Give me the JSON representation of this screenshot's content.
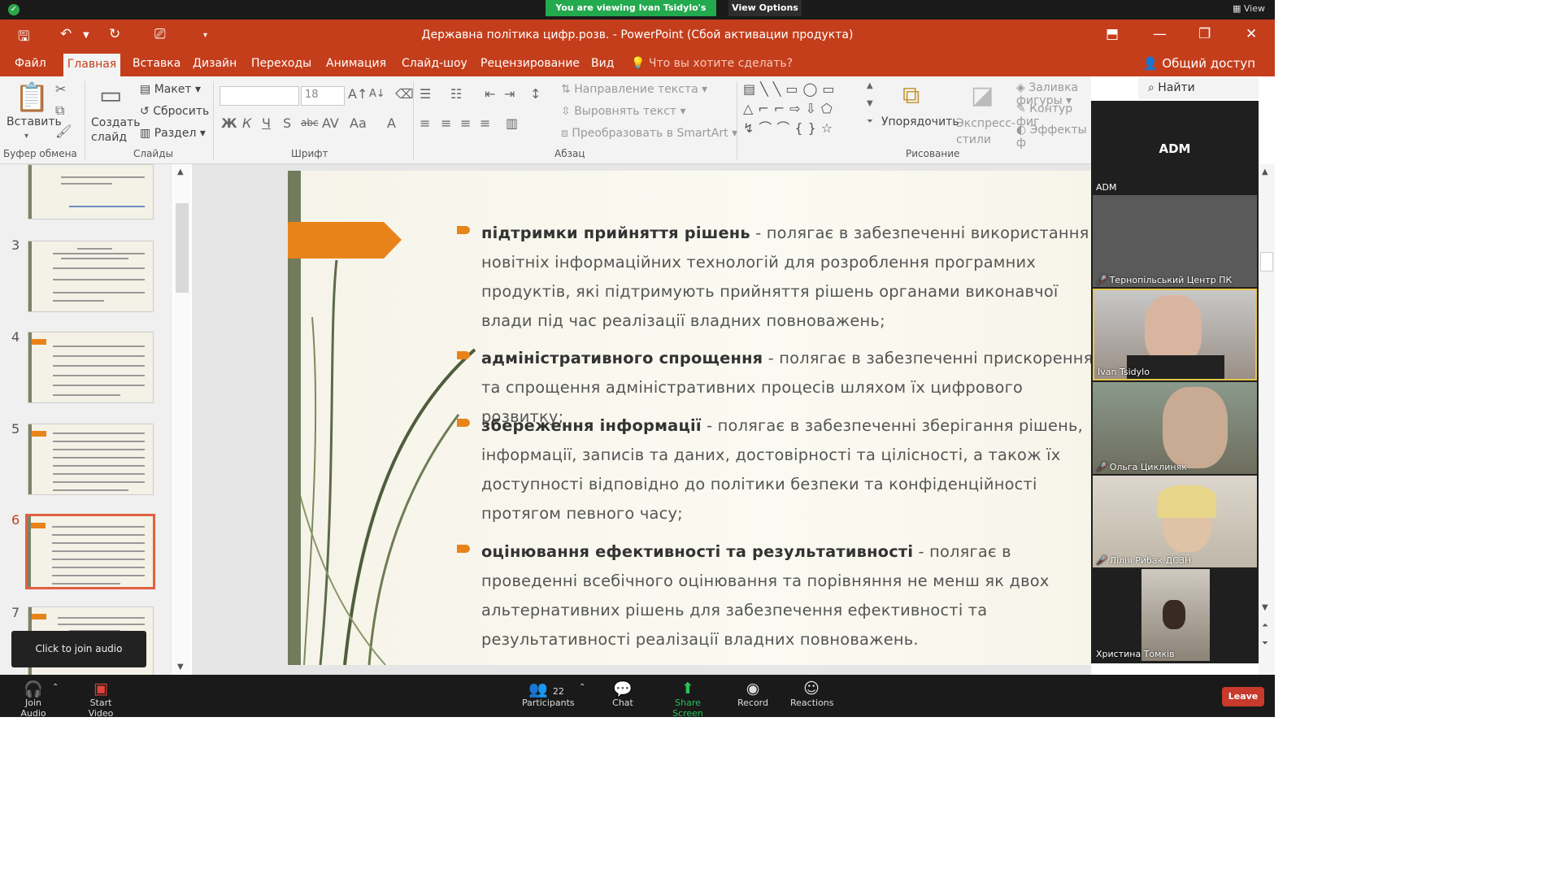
{
  "zoom_top": {
    "viewing": "You are viewing Ivan Tsidylo's screen",
    "view_options": "View Options",
    "view": "View"
  },
  "titlebar": {
    "title": "Державна політика цифр.розв. - PowerPoint (Сбой активации продукта)"
  },
  "menu": {
    "items": [
      "Файл",
      "Главная",
      "Вставка",
      "Дизайн",
      "Переходы",
      "Анимация",
      "Слайд-шоу",
      "Рецензирование",
      "Вид"
    ],
    "tell_me": "Что вы хотите сделать?",
    "share": "Общий доступ"
  },
  "ribbon": {
    "paste": "Вставить",
    "new_slide": "Создать слайд",
    "layout": "Макет",
    "reset": "Сбросить",
    "section": "Раздел",
    "font_size": "18",
    "text_direction": "Направление текста",
    "align_text": "Выровнять текст",
    "smartart": "Преобразовать в SmartArt",
    "arrange": "Упорядочить",
    "quick_styles": "Экспресс-стили",
    "shape_fill": "Заливка фигуры",
    "shape_outline": "Контур фиг",
    "shape_effects": "Эффекты ф",
    "find": "Найти",
    "groups": {
      "clipboard": "Буфер обмена",
      "slides": "Слайды",
      "font": "Шрифт",
      "paragraph": "Абзац",
      "drawing": "Рисование"
    }
  },
  "thumbnails": {
    "numbers": [
      "3",
      "4",
      "5",
      "6",
      "7"
    ],
    "selected": "6",
    "tooltip": "Click to join audio"
  },
  "slide": {
    "bullets": [
      {
        "bold": "підтримки прийняття рішень",
        "rest": " - полягає в забезпеченні використання новітніх інформаційних технологій для розроблення програмних продуктів, які підтримують прийняття рішень органами виконавчої влади під час реалізації владних повноважень;"
      },
      {
        "bold": "адміністративного спрощення",
        "rest": " - полягає в забезпеченні прискорення та спрощення адміністративних процесів шляхом їх цифрового розвитку;"
      },
      {
        "bold": "збереження інформації",
        "rest": " - полягає в забезпеченні зберігання рішень, інформації, записів та даних, достовірності та цілісності, а також їх доступності відповідно до політики безпеки та конфіденційності протягом певного часу;"
      },
      {
        "bold": "оцінювання ефективності та результативності",
        "rest": " - полягає в проведенні всебічного оцінювання та порівняння не менш як двох альтернативних рішень для забезпечення ефективності та результативності реалізації владних повноважень."
      }
    ]
  },
  "participants_panel": {
    "header": "ADM",
    "header_label": "ADM",
    "tiles": [
      "Тернопільський Центр ПК",
      "Ivan Tsidylo",
      "Ольга Циклиняк",
      "Лілія Рибак ДСЗН",
      "Христина Томків"
    ]
  },
  "zoom_bar": {
    "join_audio": "Join Audio",
    "start_video": "Start Video",
    "participants": "Participants",
    "participants_count": "22",
    "chat": "Chat",
    "share_screen": "Share Screen",
    "record": "Record",
    "reactions": "Reactions",
    "leave": "Leave"
  },
  "colors": {
    "accent": "#c43e1c",
    "slide_orange": "#e8831a",
    "zoom_green": "#23a94e",
    "leave_red": "#c73a2c"
  }
}
